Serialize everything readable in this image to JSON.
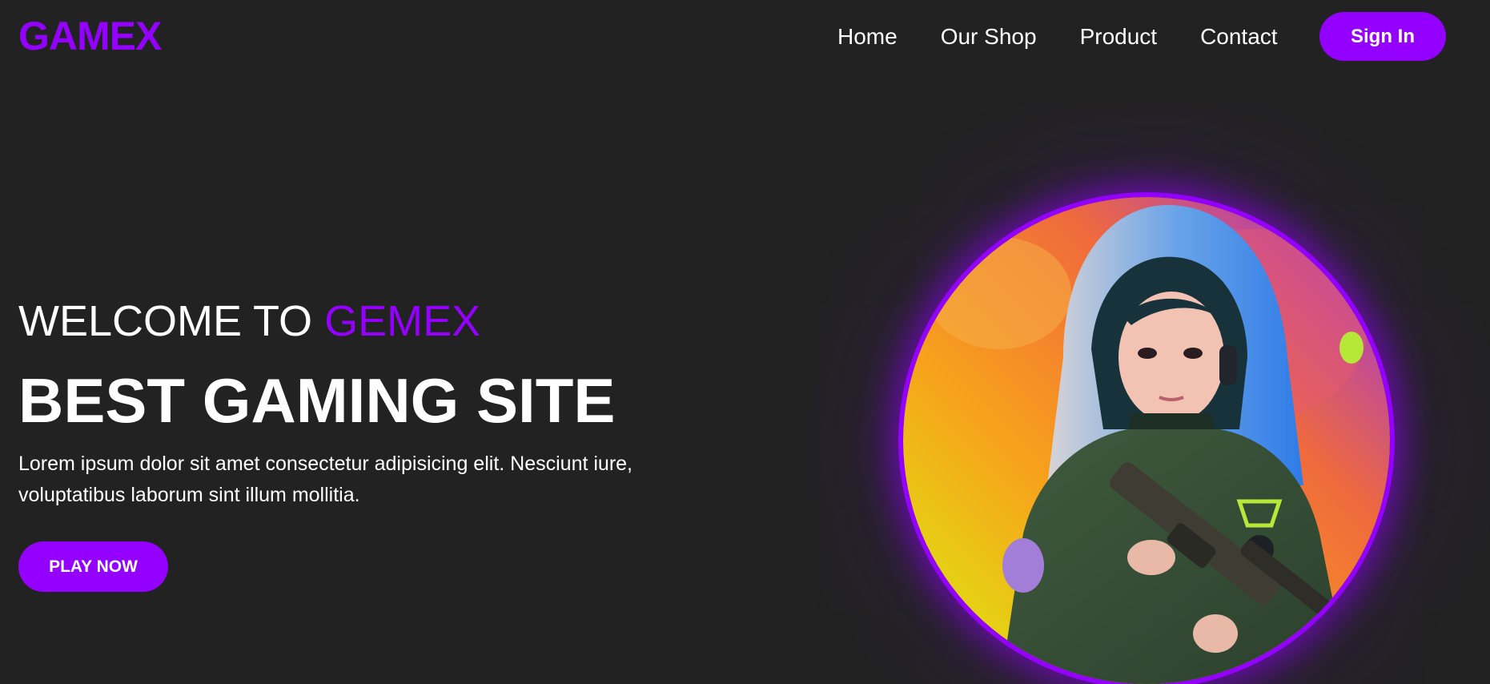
{
  "header": {
    "logo": "GAMEX",
    "nav": [
      {
        "label": "Home"
      },
      {
        "label": "Our Shop"
      },
      {
        "label": "Product"
      },
      {
        "label": "Contact"
      }
    ],
    "signin_label": "Sign In"
  },
  "hero": {
    "welcome_prefix": "WELCOME TO",
    "welcome_accent": "GEMEX",
    "headline": "BEST GAMING SITE",
    "description": "Lorem ipsum dolor sit amet consectetur adipisicing elit. Nesciunt iure, voluptatibus laborum sint illum mollitia.",
    "play_label": "PLAY NOW"
  },
  "colors": {
    "background": "#222222",
    "accent": "#9400ff",
    "text": "#ffffff"
  },
  "icons": {
    "hero_image": "gamer-girl-illustration"
  }
}
